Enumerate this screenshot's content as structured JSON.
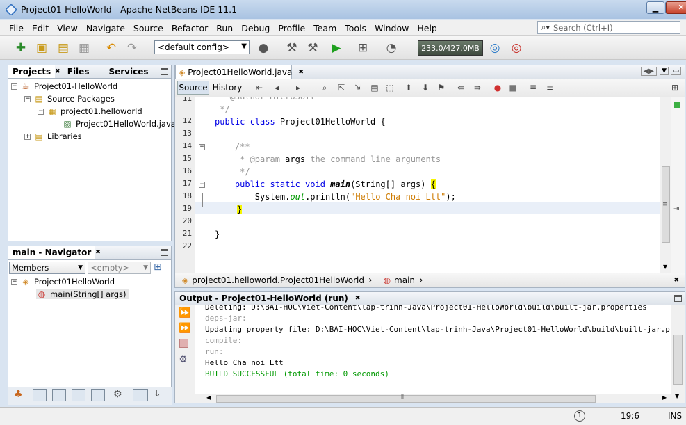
{
  "window": {
    "title": "Project01-HelloWorld - Apache NetBeans IDE 11.1"
  },
  "menu": [
    "File",
    "Edit",
    "View",
    "Navigate",
    "Source",
    "Refactor",
    "Run",
    "Debug",
    "Profile",
    "Team",
    "Tools",
    "Window",
    "Help"
  ],
  "search": {
    "placeholder": "Search (Ctrl+I)"
  },
  "toolbar": {
    "config": "<default config>",
    "memory": "233.0/427.0MB"
  },
  "projects_panel": {
    "tabs": [
      "Projects",
      "Files",
      "Services"
    ],
    "tree": {
      "project": "Project01-HelloWorld",
      "source_packages": "Source Packages",
      "package": "project01.helloworld",
      "file": "Project01HelloWorld.java",
      "libraries": "Libraries"
    }
  },
  "navigator": {
    "title": "main - Navigator",
    "filter": "Members",
    "empty": "<empty>",
    "class": "Project01HelloWorld",
    "method": "main(String[] args)"
  },
  "editor": {
    "tab": "Project01HelloWorld.java",
    "source_btn": "Source",
    "history_btn": "History",
    "line_numbers": [
      "11",
      "12",
      "13",
      "14",
      "15",
      "16",
      "17",
      "18",
      "19",
      "20",
      "21",
      "22"
    ],
    "code": {
      "l10": " * @author MicroSoft",
      "l11": " */",
      "l12_kw": "public class ",
      "l12_name": "Project01HelloWorld {",
      "l14": "    /**",
      "l15_a": "     * @param ",
      "l15_b": "args",
      "l15_c": " the command line arguments",
      "l16": "     */",
      "l17_kw": "    public static void ",
      "l17_m": "main",
      "l17_rest": "(String[] args) ",
      "l17_brace": "{",
      "l18_a": "        System.",
      "l18_b": "out",
      "l18_c": ".println(",
      "l18_d": "\"Hello Cha noi Ltt\"",
      "l18_e": ");",
      "l19_brace": "}",
      "l21": "}"
    },
    "breadcrumb": [
      "project01.helloworld.Project01HelloWorld",
      "main"
    ]
  },
  "output": {
    "title": "Output - Project01-HelloWorld (run)",
    "lines": [
      {
        "text": "Deleting: D:\\BAI-HOC\\Viet-Content\\lap-trinh-Java\\Project01-HelloWorld\\build\\built-jar.properties",
        "style": "normal"
      },
      {
        "text": "deps-jar:",
        "style": "dim"
      },
      {
        "text": "Updating property file: D:\\BAI-HOC\\Viet-Content\\lap-trinh-Java\\Project01-HelloWorld\\build\\built-jar.properties",
        "style": "normal"
      },
      {
        "text": "compile:",
        "style": "dim"
      },
      {
        "text": "run:",
        "style": "dim"
      },
      {
        "text": "Hello Cha noi Ltt",
        "style": "normal"
      },
      {
        "text": "BUILD SUCCESSFUL (total time: 0 seconds)",
        "style": "ok"
      }
    ]
  },
  "status": {
    "position": "19:6",
    "mode": "INS",
    "notifications": "1"
  }
}
